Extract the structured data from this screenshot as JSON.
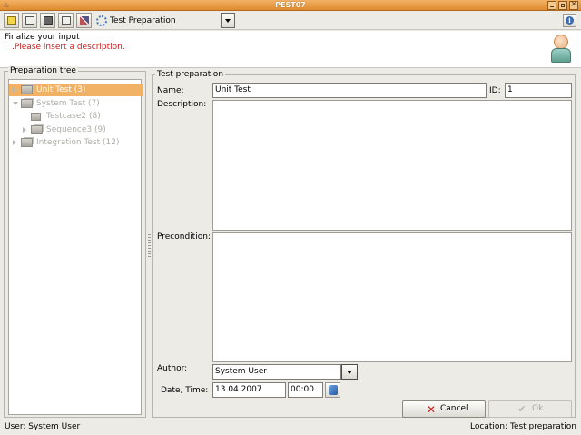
{
  "window": {
    "title": "PEST07"
  },
  "toolbar": {
    "buttons": [
      {
        "name": "new-icon"
      },
      {
        "name": "open-folder-icon"
      },
      {
        "name": "save-icon"
      },
      {
        "name": "export-icon"
      },
      {
        "name": "tools-icon"
      }
    ],
    "section_icon": "gear-icon",
    "section_label": "Test Preparation"
  },
  "message": {
    "title": "Finalize your input",
    "error": ".Please insert a description."
  },
  "tree": {
    "title": "Preparation tree",
    "items": [
      {
        "label": "Unit Test (3)",
        "level": 0,
        "expander": "collapsed",
        "selected": true
      },
      {
        "label": "System Test (7)",
        "level": 0,
        "expander": "expanded",
        "selected": false
      },
      {
        "label": "Testcase2 (8)",
        "level": 1,
        "expander": "none",
        "selected": false
      },
      {
        "label": "Sequence3 (9)",
        "level": 1,
        "expander": "collapsed",
        "selected": false
      },
      {
        "label": "Integration Test (12)",
        "level": 0,
        "expander": "collapsed",
        "selected": false
      }
    ]
  },
  "form": {
    "title": "Test preparation",
    "name_label": "Name:",
    "name_value": "Unit Test",
    "id_label": "ID:",
    "id_value": "1",
    "description_label": "Description:",
    "description_value": "",
    "precondition_label": "Precondition:",
    "precondition_value": "",
    "author_label": "Author:",
    "author_value": "System User",
    "datetime_label": "Date, Time:",
    "date_value": "13.04.2007",
    "time_value": "00:00",
    "cancel_label": "Cancel",
    "ok_label": "Ok"
  },
  "status": {
    "user": "User: System User",
    "location": "Location: Test preparation"
  },
  "colors": {
    "accent": "#f2b266",
    "error": "#c81e1e"
  }
}
